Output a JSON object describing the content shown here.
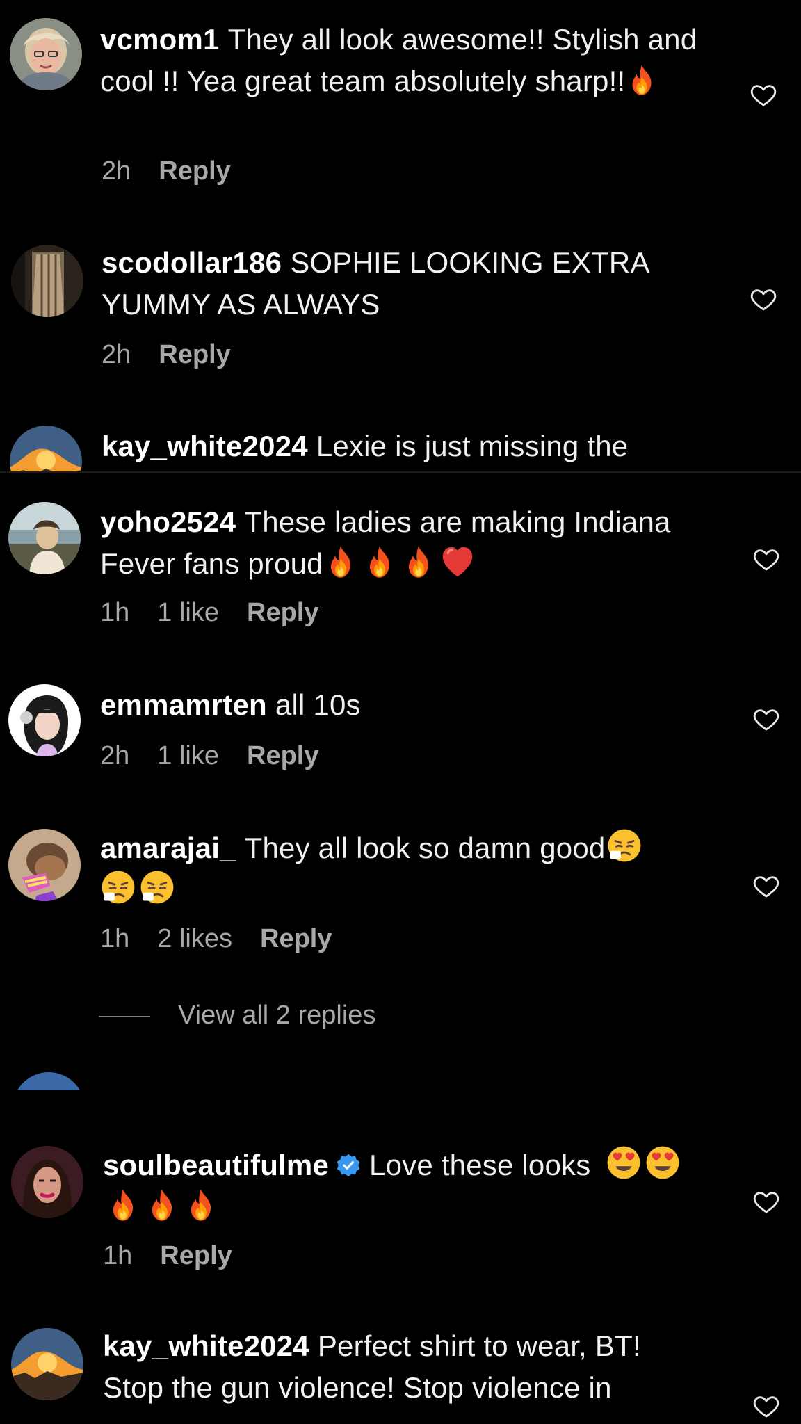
{
  "colors": {
    "background": "#000000",
    "text": "#f1f1f1",
    "meta_text": "#a8a8a8",
    "verified_badge": "#3897f0"
  },
  "comments": [
    {
      "username": "vcmom1",
      "text": "They all look awesome!! Stylish and cool !! Yea great team absolutely sharp!!",
      "emojis": [
        "fire-emoji"
      ],
      "time": "2h",
      "likes": "",
      "reply": "Reply"
    },
    {
      "username": "scodollar186",
      "text": "SOPHIE LOOKING EXTRA YUMMY AS ALWAYS",
      "emojis": [],
      "time": "2h",
      "likes": "",
      "reply": "Reply"
    },
    {
      "username": "kay_white2024",
      "text": "Lexie is just missing the",
      "emojis": [],
      "cut_off": true
    },
    {
      "username": "yoho2524",
      "text": "These ladies are making Indiana Fever fans proud",
      "emojis": [
        "fire-emoji",
        "fire-emoji",
        "fire-emoji",
        "red-heart-emoji"
      ],
      "time": "1h",
      "likes": "1 like",
      "reply": "Reply"
    },
    {
      "username": "emmamrten",
      "text": "all 10s",
      "emojis": [],
      "time": "2h",
      "likes": "1 like",
      "reply": "Reply"
    },
    {
      "username": "amarajai_",
      "text": "They all look so damn good",
      "emojis": [
        "persevering-face-emoji",
        "persevering-face-emoji",
        "persevering-face-emoji"
      ],
      "time": "1h",
      "likes": "2 likes",
      "reply": "Reply",
      "view_replies": "View all 2 replies"
    },
    {
      "username": "soulbeautifulme",
      "verified": true,
      "text": "Love these looks",
      "emojis": [
        "heart-eyes-emoji",
        "heart-eyes-emoji",
        "fire-emoji",
        "fire-emoji",
        "fire-emoji"
      ],
      "time": "1h",
      "likes": "",
      "reply": "Reply"
    },
    {
      "username": "kay_white2024",
      "text": "Perfect shirt to wear, BT! Stop the gun violence! Stop violence in",
      "emojis": [],
      "cut_off": true
    }
  ]
}
